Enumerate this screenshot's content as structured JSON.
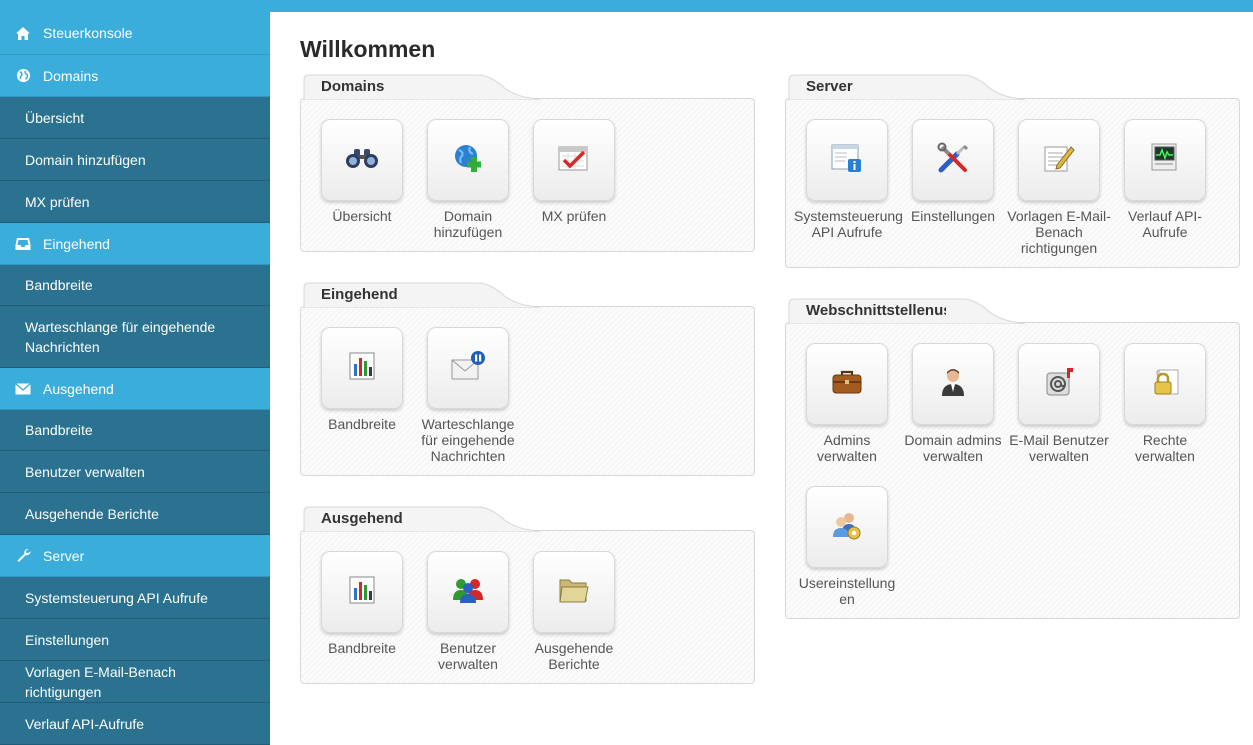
{
  "sidebar": {
    "items": [
      {
        "label": "Steuerkonsole",
        "type": "head",
        "icon": "home-icon"
      },
      {
        "label": "Domains",
        "type": "head",
        "icon": "globe-icon"
      },
      {
        "label": "Übersicht",
        "type": "sub"
      },
      {
        "label": "Domain hinzufügen",
        "type": "sub"
      },
      {
        "label": "MX prüfen",
        "type": "sub"
      },
      {
        "label": "Eingehend",
        "type": "head",
        "icon": "inbox-icon"
      },
      {
        "label": "Bandbreite",
        "type": "sub"
      },
      {
        "label": "Warteschlange für eingehende Nachrichten",
        "type": "sub"
      },
      {
        "label": "Ausgehend",
        "type": "head",
        "icon": "envelope-icon"
      },
      {
        "label": "Bandbreite",
        "type": "sub"
      },
      {
        "label": "Benutzer verwalten",
        "type": "sub"
      },
      {
        "label": "Ausgehende Berichte",
        "type": "sub"
      },
      {
        "label": "Server",
        "type": "head",
        "icon": "wrench-icon"
      },
      {
        "label": "Systemsteuerung API Aufrufe",
        "type": "sub"
      },
      {
        "label": "Einstellungen",
        "type": "sub"
      },
      {
        "label": "Vorlagen E-Mail-Benach richtigungen",
        "type": "sub"
      },
      {
        "label": "Verlauf API-Aufrufe",
        "type": "sub"
      }
    ]
  },
  "main": {
    "title": "Willkommen",
    "panels": [
      {
        "title": "Domains",
        "tiles": [
          {
            "label": "Übersicht",
            "icon": "binoculars-icon"
          },
          {
            "label": "Domain hinzufügen",
            "icon": "globe-add-icon"
          },
          {
            "label": "MX prüfen",
            "icon": "check-calendar-icon"
          }
        ]
      },
      {
        "title": "Eingehend",
        "tiles": [
          {
            "label": "Bandbreite",
            "icon": "bar-chart-icon"
          },
          {
            "label": "Warteschlange für eingehende Nachrichten",
            "icon": "mail-pause-icon"
          }
        ]
      },
      {
        "title": "Ausgehend",
        "tiles": [
          {
            "label": "Bandbreite",
            "icon": "bar-chart-icon"
          },
          {
            "label": "Benutzer verwalten",
            "icon": "users-icon"
          },
          {
            "label": "Ausgehende Berichte",
            "icon": "folder-icon"
          }
        ]
      },
      {
        "title": "Server",
        "tiles": [
          {
            "label": "Systemsteuerung API Aufrufe",
            "icon": "window-info-icon"
          },
          {
            "label": "Einstellungen",
            "icon": "tools-icon"
          },
          {
            "label": "Vorlagen E-Mail-Benach richtigungen",
            "icon": "edit-document-icon"
          },
          {
            "label": "Verlauf API-Aufrufe",
            "icon": "monitor-chart-icon"
          }
        ]
      },
      {
        "title": "Webschnittstellenus",
        "tiles": [
          {
            "label": "Admins verwalten",
            "icon": "briefcase-icon"
          },
          {
            "label": "Domain admins verwalten",
            "icon": "person-icon"
          },
          {
            "label": "E-Mail Benutzer verwalten",
            "icon": "mail-at-icon"
          },
          {
            "label": "Rechte verwalten",
            "icon": "lock-document-icon"
          },
          {
            "label": "Usereinstellung en",
            "icon": "users-settings-icon"
          }
        ]
      }
    ]
  }
}
